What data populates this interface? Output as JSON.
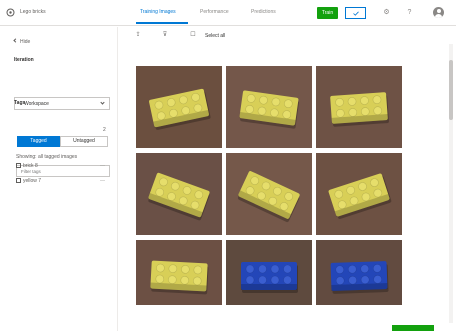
{
  "header": {
    "app_title": "Lego bricks",
    "tabs": [
      {
        "label": "Training Images"
      },
      {
        "label": "Performance"
      },
      {
        "label": "Predictions"
      }
    ],
    "train_label": "Train",
    "icons": [
      "quick-test-icon",
      "settings-icon",
      "help-icon",
      "avatar"
    ]
  },
  "sidebar": {
    "hide_label": "Hide",
    "iteration_label": "Iteration",
    "iteration_value": "Workspace",
    "tags_label": "Tags",
    "tags_count": "2",
    "toggle_tagged": "Tagged",
    "toggle_untagged": "Untagged",
    "filter_text": "Showing: all tagged images",
    "filter_placeholder": "Filter tags",
    "tags": [
      {
        "label": "brick  8",
        "count": "—"
      },
      {
        "label": "yellow  7",
        "count": "—"
      }
    ]
  },
  "toolbar": {
    "select_label": "Select all"
  },
  "images": [
    {
      "color": "yellow"
    },
    {
      "color": "yellow"
    },
    {
      "color": "yellow"
    },
    {
      "color": "yellow"
    },
    {
      "color": "yellow"
    },
    {
      "color": "yellow"
    },
    {
      "color": "yellow"
    },
    {
      "color": "blue"
    },
    {
      "color": "blue"
    }
  ],
  "colors": {
    "accent": "#0078d4",
    "train": "#13a10e",
    "background": "#6b4f3f",
    "yellow_brick": "#d8cf57",
    "blue_brick": "#2346b8"
  }
}
